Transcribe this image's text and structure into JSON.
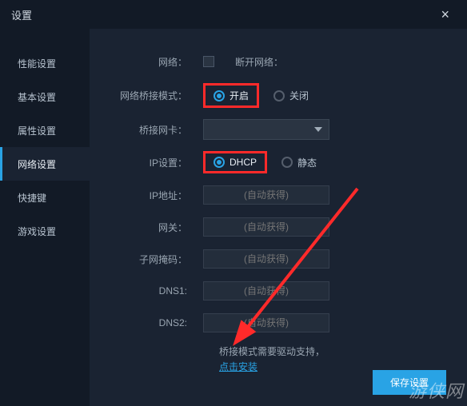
{
  "window": {
    "title": "设置"
  },
  "sidebar": {
    "items": [
      {
        "label": "性能设置"
      },
      {
        "label": "基本设置"
      },
      {
        "label": "属性设置"
      },
      {
        "label": "网络设置"
      },
      {
        "label": "快捷键"
      },
      {
        "label": "游戏设置"
      }
    ],
    "active_index": 3
  },
  "form": {
    "network_label": "网络：",
    "disconnect_label": "断开网络：",
    "bridge_mode_label": "网络桥接模式：",
    "bridge_on": "开启",
    "bridge_off": "关闭",
    "nic_label": "桥接网卡：",
    "ip_mode_label": "IP设置：",
    "ip_dhcp": "DHCP",
    "ip_static": "静态",
    "ipaddr_label": "IP地址：",
    "gateway_label": "网关：",
    "subnet_label": "子网掩码：",
    "dns1_label": "DNS1:",
    "dns2_label": "DNS2:",
    "auto_placeholder": "(自动获得)",
    "hint_text": "桥接模式需要驱动支持，",
    "hint_link": "点击安装",
    "save": "保存设置"
  },
  "colors": {
    "accent": "#29a3e5",
    "highlight": "#ff2a2a",
    "bg": "#1a2332",
    "panel": "#121a26"
  },
  "watermark": "游侠网"
}
